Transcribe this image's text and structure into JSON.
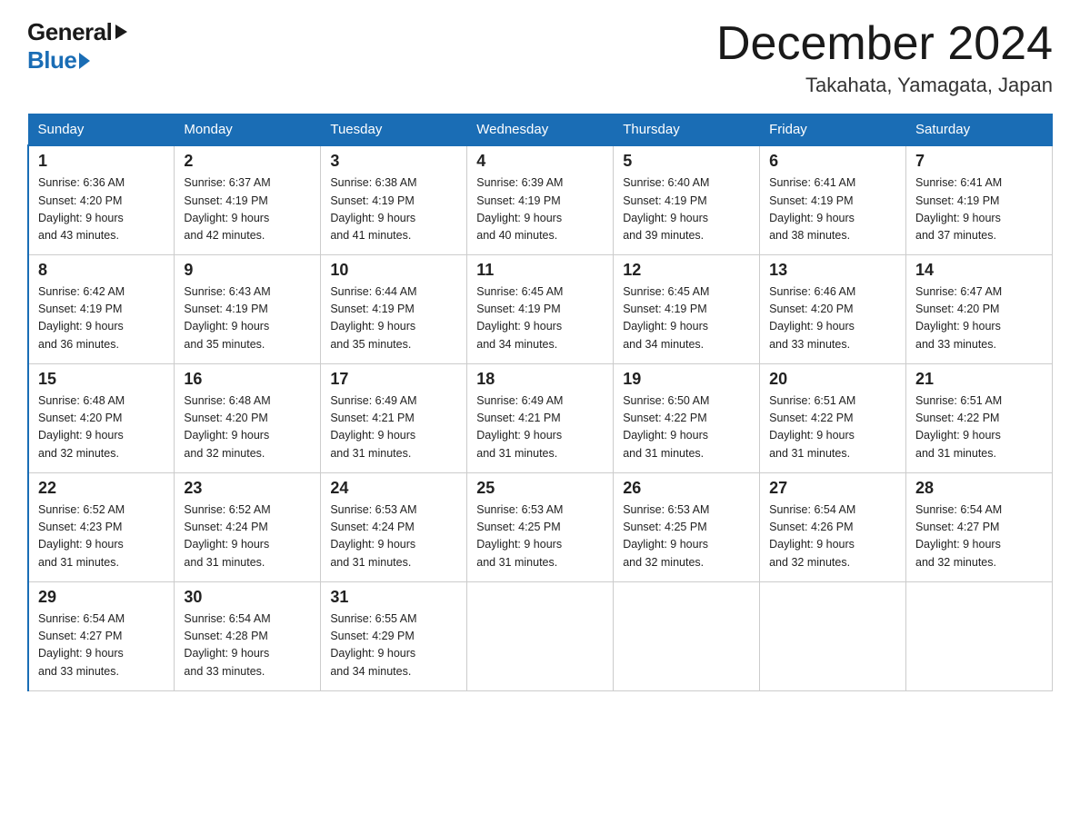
{
  "logo": {
    "general": "General",
    "blue": "Blue"
  },
  "header": {
    "month": "December 2024",
    "location": "Takahata, Yamagata, Japan"
  },
  "weekdays": [
    "Sunday",
    "Monday",
    "Tuesday",
    "Wednesday",
    "Thursday",
    "Friday",
    "Saturday"
  ],
  "weeks": [
    [
      {
        "day": "1",
        "sunrise": "6:36 AM",
        "sunset": "4:20 PM",
        "daylight": "9 hours and 43 minutes."
      },
      {
        "day": "2",
        "sunrise": "6:37 AM",
        "sunset": "4:19 PM",
        "daylight": "9 hours and 42 minutes."
      },
      {
        "day": "3",
        "sunrise": "6:38 AM",
        "sunset": "4:19 PM",
        "daylight": "9 hours and 41 minutes."
      },
      {
        "day": "4",
        "sunrise": "6:39 AM",
        "sunset": "4:19 PM",
        "daylight": "9 hours and 40 minutes."
      },
      {
        "day": "5",
        "sunrise": "6:40 AM",
        "sunset": "4:19 PM",
        "daylight": "9 hours and 39 minutes."
      },
      {
        "day": "6",
        "sunrise": "6:41 AM",
        "sunset": "4:19 PM",
        "daylight": "9 hours and 38 minutes."
      },
      {
        "day": "7",
        "sunrise": "6:41 AM",
        "sunset": "4:19 PM",
        "daylight": "9 hours and 37 minutes."
      }
    ],
    [
      {
        "day": "8",
        "sunrise": "6:42 AM",
        "sunset": "4:19 PM",
        "daylight": "9 hours and 36 minutes."
      },
      {
        "day": "9",
        "sunrise": "6:43 AM",
        "sunset": "4:19 PM",
        "daylight": "9 hours and 35 minutes."
      },
      {
        "day": "10",
        "sunrise": "6:44 AM",
        "sunset": "4:19 PM",
        "daylight": "9 hours and 35 minutes."
      },
      {
        "day": "11",
        "sunrise": "6:45 AM",
        "sunset": "4:19 PM",
        "daylight": "9 hours and 34 minutes."
      },
      {
        "day": "12",
        "sunrise": "6:45 AM",
        "sunset": "4:19 PM",
        "daylight": "9 hours and 34 minutes."
      },
      {
        "day": "13",
        "sunrise": "6:46 AM",
        "sunset": "4:20 PM",
        "daylight": "9 hours and 33 minutes."
      },
      {
        "day": "14",
        "sunrise": "6:47 AM",
        "sunset": "4:20 PM",
        "daylight": "9 hours and 33 minutes."
      }
    ],
    [
      {
        "day": "15",
        "sunrise": "6:48 AM",
        "sunset": "4:20 PM",
        "daylight": "9 hours and 32 minutes."
      },
      {
        "day": "16",
        "sunrise": "6:48 AM",
        "sunset": "4:20 PM",
        "daylight": "9 hours and 32 minutes."
      },
      {
        "day": "17",
        "sunrise": "6:49 AM",
        "sunset": "4:21 PM",
        "daylight": "9 hours and 31 minutes."
      },
      {
        "day": "18",
        "sunrise": "6:49 AM",
        "sunset": "4:21 PM",
        "daylight": "9 hours and 31 minutes."
      },
      {
        "day": "19",
        "sunrise": "6:50 AM",
        "sunset": "4:22 PM",
        "daylight": "9 hours and 31 minutes."
      },
      {
        "day": "20",
        "sunrise": "6:51 AM",
        "sunset": "4:22 PM",
        "daylight": "9 hours and 31 minutes."
      },
      {
        "day": "21",
        "sunrise": "6:51 AM",
        "sunset": "4:22 PM",
        "daylight": "9 hours and 31 minutes."
      }
    ],
    [
      {
        "day": "22",
        "sunrise": "6:52 AM",
        "sunset": "4:23 PM",
        "daylight": "9 hours and 31 minutes."
      },
      {
        "day": "23",
        "sunrise": "6:52 AM",
        "sunset": "4:24 PM",
        "daylight": "9 hours and 31 minutes."
      },
      {
        "day": "24",
        "sunrise": "6:53 AM",
        "sunset": "4:24 PM",
        "daylight": "9 hours and 31 minutes."
      },
      {
        "day": "25",
        "sunrise": "6:53 AM",
        "sunset": "4:25 PM",
        "daylight": "9 hours and 31 minutes."
      },
      {
        "day": "26",
        "sunrise": "6:53 AM",
        "sunset": "4:25 PM",
        "daylight": "9 hours and 32 minutes."
      },
      {
        "day": "27",
        "sunrise": "6:54 AM",
        "sunset": "4:26 PM",
        "daylight": "9 hours and 32 minutes."
      },
      {
        "day": "28",
        "sunrise": "6:54 AM",
        "sunset": "4:27 PM",
        "daylight": "9 hours and 32 minutes."
      }
    ],
    [
      {
        "day": "29",
        "sunrise": "6:54 AM",
        "sunset": "4:27 PM",
        "daylight": "9 hours and 33 minutes."
      },
      {
        "day": "30",
        "sunrise": "6:54 AM",
        "sunset": "4:28 PM",
        "daylight": "9 hours and 33 minutes."
      },
      {
        "day": "31",
        "sunrise": "6:55 AM",
        "sunset": "4:29 PM",
        "daylight": "9 hours and 34 minutes."
      },
      null,
      null,
      null,
      null
    ]
  ],
  "labels": {
    "sunrise": "Sunrise:",
    "sunset": "Sunset:",
    "daylight": "Daylight:"
  }
}
